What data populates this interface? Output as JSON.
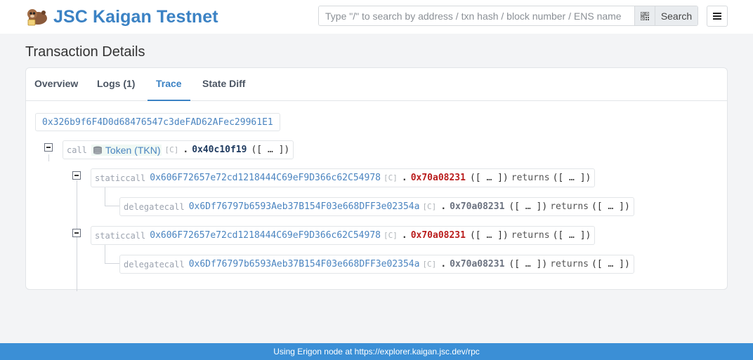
{
  "header": {
    "brand": "JSC Kaigan Testnet",
    "search_placeholder": "Type \"/\" to search by address / txn hash / block number / ENS name",
    "search_button": "Search"
  },
  "page": {
    "title": "Transaction Details"
  },
  "tabs": [
    {
      "label": "Overview",
      "active": false
    },
    {
      "label": "Logs (1)",
      "active": false
    },
    {
      "label": "Trace",
      "active": true
    },
    {
      "label": "State Diff",
      "active": false
    }
  ],
  "trace": {
    "root_address": "0x326b9f6F4D0d68476547c3deFAD62AFec29961E1",
    "nodes": [
      {
        "kind": "call",
        "token_name": "Token (TKN)",
        "contract_tag": "[C]",
        "dot": ".",
        "selector": "0x40c10f19",
        "args": "([ … ])"
      },
      {
        "kind": "staticcall",
        "address": "0x606F72657e72cd1218444C69eF9D366c62C54978",
        "contract_tag": "[C]",
        "dot": ".",
        "selector": "0x70a08231",
        "args": "([ … ])",
        "returns_label": "returns",
        "returns": "([ … ])"
      },
      {
        "kind": "delegatecall",
        "address": "0x6Df76797b6593Aeb37B154F03e668DFF3e02354a",
        "contract_tag": "[C]",
        "dot": ".",
        "selector": "0x70a08231",
        "args": "([ … ])",
        "returns_label": "returns",
        "returns": "([ … ])"
      },
      {
        "kind": "staticcall",
        "address": "0x606F72657e72cd1218444C69eF9D366c62C54978",
        "contract_tag": "[C]",
        "dot": ".",
        "selector": "0x70a08231",
        "args": "([ … ])",
        "returns_label": "returns",
        "returns": "([ … ])"
      },
      {
        "kind": "delegatecall",
        "address": "0x6Df76797b6593Aeb37B154F03e668DFF3e02354a",
        "contract_tag": "[C]",
        "dot": ".",
        "selector": "0x70a08231",
        "args": "([ … ])",
        "returns_label": "returns",
        "returns": "([ … ])"
      }
    ]
  },
  "footer": {
    "text": "Using Erigon node at https://explorer.kaigan.jsc.dev/rpc"
  },
  "colors": {
    "accent": "#3b82c4",
    "footer_bg": "#3b8fd6",
    "selector_red": "#b91c1c",
    "address_blue": "#4a84c0"
  },
  "icons": [
    "otter-logo-icon",
    "qr-code-icon",
    "hamburger-menu-icon",
    "collapse-toggle-icon",
    "coins-icon"
  ]
}
